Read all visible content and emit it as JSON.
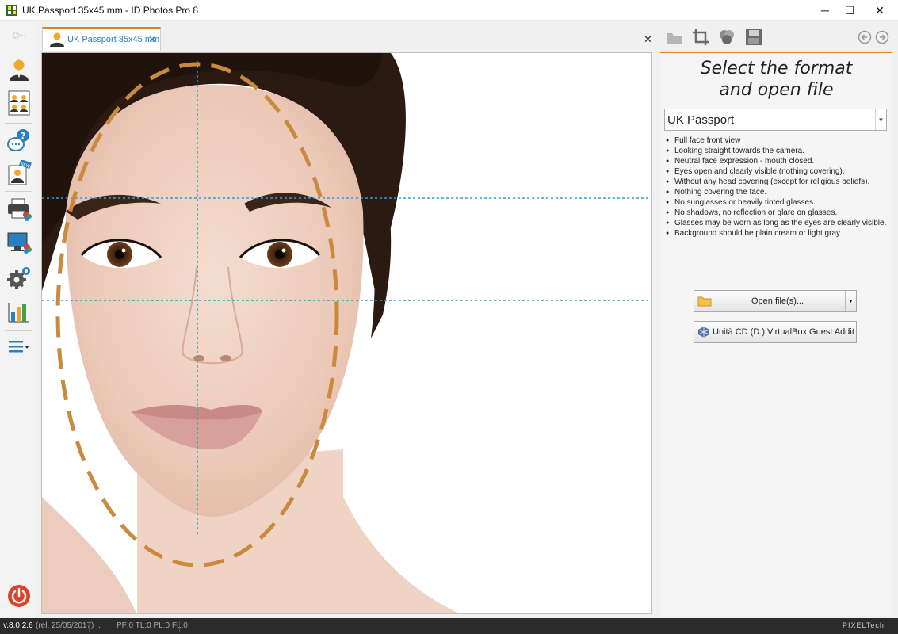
{
  "window": {
    "title": "UK Passport 35x45 mm - ID Photos Pro 8",
    "minimize": "─",
    "maximize": "☐",
    "close": "✕"
  },
  "document_tab": {
    "label": "UK Passport 35x45 mm",
    "close": "✕"
  },
  "doc_close": "✕",
  "sidebar": {
    "items": [
      "single-photo",
      "multi-photo",
      "help",
      "whats-new",
      "print",
      "display",
      "settings",
      "statistics",
      "menu",
      "power"
    ]
  },
  "toolbar": {
    "icons": [
      "open-folder-icon",
      "crop-icon",
      "color-adjust-icon",
      "save-icon",
      "back-icon",
      "forward-icon"
    ]
  },
  "panel": {
    "title_line1": "Select the format",
    "title_line2": "and open file",
    "format_select": {
      "selected": "UK Passport"
    },
    "requirements": [
      "Full face front view",
      "Looking straight towards the camera.",
      "Neutral face expression - mouth closed.",
      "Eyes open and clearly visible (nothing covering).",
      "Without any head covering (except for religious beliefs).",
      "Nothing covering the face.",
      "No sunglasses or heavily tinted glasses.",
      "No shadows, no reflection or glare on glasses.",
      "Glasses may be worn as long as the eyes are clearly visible.",
      "Background should be plain cream or light gray."
    ],
    "open_button": "Open file(s)...",
    "cd_button": "Unità CD (D:) VirtualBox Guest Addit"
  },
  "status": {
    "version": "v.8.0.2.6",
    "release": "(rel. 25/05/2017)",
    "dot": ".",
    "flags": "PF:0 TL:0 PL:0 FL:0",
    "brand": "PIXELTech"
  },
  "colors": {
    "accent": "#d9822b",
    "tab_text": "#2a7fc1",
    "guide_line": "#2b9fd6",
    "oval": "#c98a3e"
  }
}
